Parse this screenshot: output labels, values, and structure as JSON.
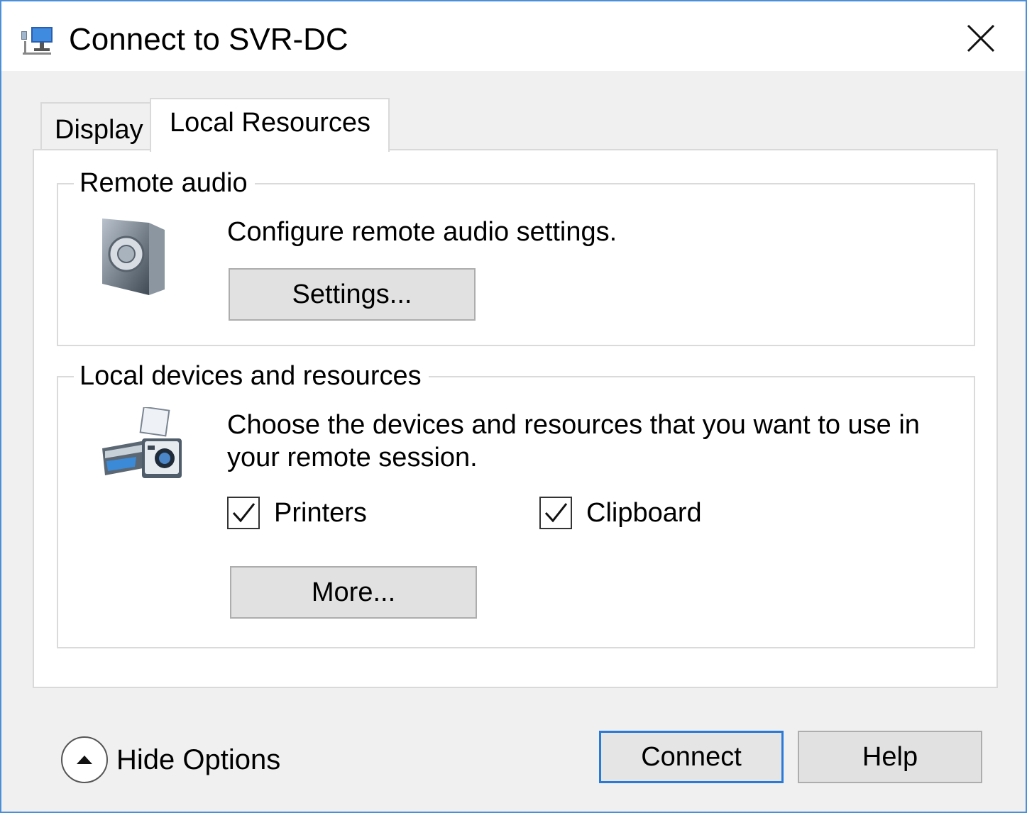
{
  "window": {
    "title": "Connect to SVR-DC",
    "accent_color": "#4a8fd8"
  },
  "tabs": [
    {
      "label": "Display",
      "selected": false
    },
    {
      "label": "Local Resources",
      "selected": true
    }
  ],
  "remote_audio": {
    "group_label": "Remote audio",
    "description": "Configure remote audio settings.",
    "settings_button": "Settings...",
    "icon": "speaker-icon"
  },
  "local_devices": {
    "group_label": "Local devices and resources",
    "description_line1": "Choose the devices and resources that you want to use in",
    "description_line2": "your remote session.",
    "icon": "devices-icon",
    "checkboxes": [
      {
        "label": "Printers",
        "checked": true
      },
      {
        "label": "Clipboard",
        "checked": true
      }
    ],
    "more_button": "More..."
  },
  "footer": {
    "hide_options_label": "Hide Options",
    "connect_button": "Connect",
    "help_button": "Help"
  }
}
